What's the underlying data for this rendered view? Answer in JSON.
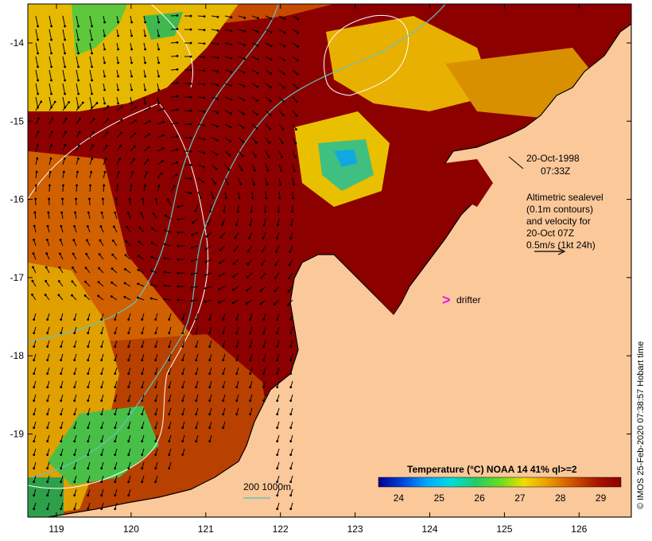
{
  "map": {
    "date_time": "20-Oct-1998",
    "time": "07:33Z",
    "annotation_lines": [
      "Altimetric sealevel",
      "(0.1m contours)",
      "and velocity for",
      "20-Oct 07Z",
      "0.5m/s (1kt 24h)"
    ],
    "drifter_label": "drifter",
    "drifter_symbol": ">",
    "depth_contours_label": "200  1000m",
    "credit": "© IMOS 25-Feb-2020 07:38:57 Hobart time",
    "longitude_ticks": [
      "119",
      "120",
      "121",
      "122",
      "123",
      "124",
      "125",
      "126"
    ],
    "latitude_ticks": [
      "-14",
      "-15",
      "-16",
      "-17",
      "-18",
      "-19"
    ],
    "colors": {
      "land": "#fbc89a",
      "coastline": "#000000",
      "sealevel_contour": "#ffffff",
      "depth_200m": "#5fc6c6",
      "drifter": "#e01ae0"
    }
  },
  "legend": {
    "title": "Temperature (°C) NOAA 14 41% ql>=2",
    "ticks": [
      "24",
      "25",
      "26",
      "27",
      "28",
      "29"
    ],
    "range": [
      23.5,
      29.5
    ],
    "colors": [
      "#00008c",
      "#0044dd",
      "#00aaff",
      "#00dddd",
      "#22cc66",
      "#66dd22",
      "#eedd00",
      "#ee9900",
      "#cc5500",
      "#aa1500",
      "#8c0000"
    ]
  }
}
